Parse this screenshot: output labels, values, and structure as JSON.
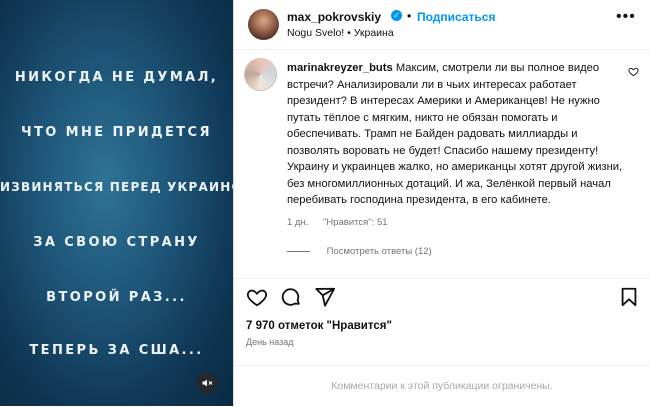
{
  "media": {
    "lines": [
      "НИКОГДА НЕ ДУМАЛ,",
      "ЧТО МНЕ ПРИДЕТСЯ",
      "ИЗВИНЯТЬСЯ ПЕРЕД УКРАИНОЙ",
      "ЗА СВОЮ СТРАНУ",
      "ВТОРОЙ РАЗ...",
      "ТЕПЕРЬ ЗА США..."
    ],
    "mute_icon": "speaker-muted-icon"
  },
  "header": {
    "username": "max_pokrovskiy",
    "verified_icon": "verified-badge-icon",
    "separator": "•",
    "follow_label": "Подписаться",
    "subtitle": "Nogu Svelo! • Украина",
    "more_icon": "more-options-icon"
  },
  "comment": {
    "username": "marinakreyzer_buts",
    "text": "Максим, смотрели ли вы полное видео встречи? Анализировали ли в чьих интересах работает президент? В интересах Америки и Американцев! Не нужно путать тёплое с мягким, никто не обязан помогать и обеспечивать. Трамп не Байден радовать миллиарды и позволять воровать не будет! Спасибо нашему президенту! Украину и украинцев жалко, но американцы хотят другой жизни, без многомиллионных дотаций. И жа, Зелёнкой первый начал перебивать господина президента, в его кабинете.",
    "time": "1 дн.",
    "likes_label": "\"Нравится\": 51",
    "replies_label": "Посмотреть ответы (12)"
  },
  "actions": {
    "like_icon": "heart-icon",
    "comment_icon": "comment-icon",
    "share_icon": "share-icon",
    "save_icon": "bookmark-icon"
  },
  "likes": "7 970 отметок \"Нравится\"",
  "posted": "День назад",
  "footer": "Комментарии к этой публикации ограничены.",
  "colors": {
    "accent": "#0095f6",
    "muted_text": "#737373",
    "media_bg": "#1d5477"
  }
}
